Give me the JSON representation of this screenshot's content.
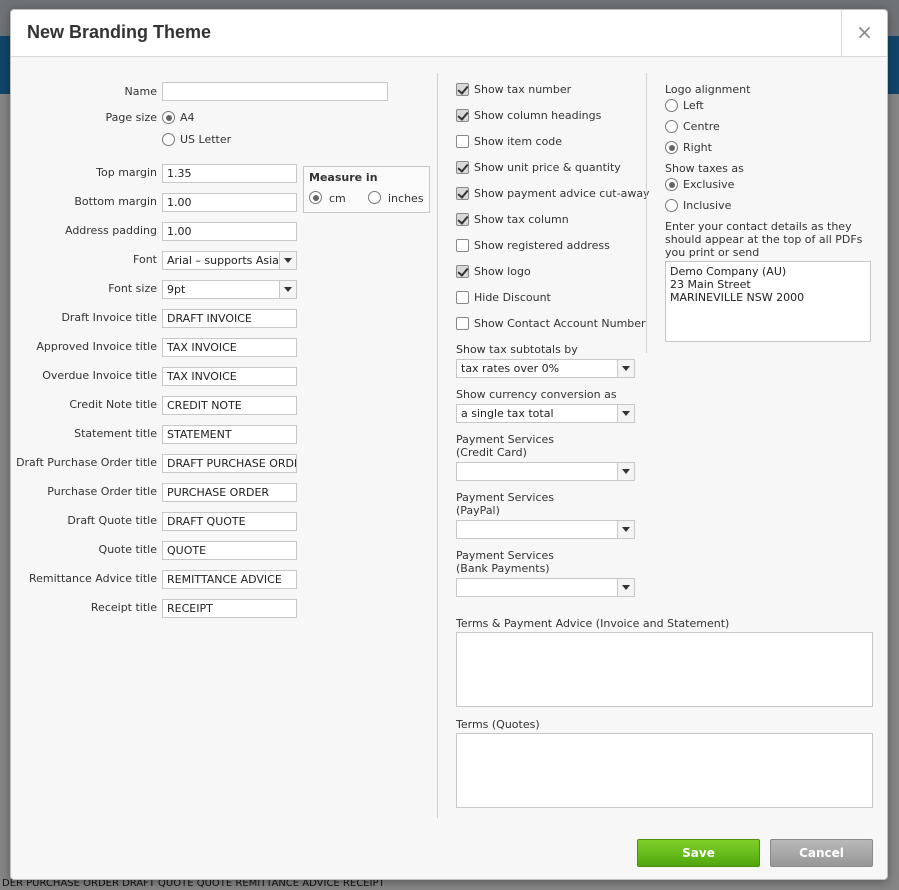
{
  "dialog": {
    "title": "New Branding Theme",
    "close_label": "×"
  },
  "background": {
    "bottom_text": "DER  PURCHASE ORDER  DRAFT QUOTE  QUOTE  REMITTANCE ADVICE  RECEIPT"
  },
  "left": {
    "name": {
      "label": "Name",
      "value": ""
    },
    "page_size": {
      "label": "Page size",
      "options": [
        "A4",
        "US Letter"
      ],
      "selected": "A4"
    },
    "top_margin": {
      "label": "Top margin",
      "value": "1.35"
    },
    "bottom_margin": {
      "label": "Bottom margin",
      "value": "1.00"
    },
    "address_padding": {
      "label": "Address padding",
      "value": "1.00"
    },
    "measure": {
      "label": "Measure in",
      "options": [
        "cm",
        "inches"
      ],
      "selected": "cm"
    },
    "font": {
      "label": "Font",
      "value": "Arial – supports Asian l"
    },
    "font_size": {
      "label": "Font size",
      "value": "9pt"
    },
    "titles": [
      {
        "label": "Draft Invoice title",
        "value": "DRAFT INVOICE"
      },
      {
        "label": "Approved Invoice title",
        "value": "TAX INVOICE"
      },
      {
        "label": "Overdue Invoice title",
        "value": "TAX INVOICE"
      },
      {
        "label": "Credit Note title",
        "value": "CREDIT NOTE"
      },
      {
        "label": "Statement title",
        "value": "STATEMENT"
      },
      {
        "label": "Draft Purchase Order title",
        "value": "DRAFT PURCHASE ORDER"
      },
      {
        "label": "Purchase Order title",
        "value": "PURCHASE ORDER"
      },
      {
        "label": "Draft Quote title",
        "value": "DRAFT QUOTE"
      },
      {
        "label": "Quote title",
        "value": "QUOTE"
      },
      {
        "label": "Remittance Advice title",
        "value": "REMITTANCE ADVICE"
      },
      {
        "label": "Receipt title",
        "value": "RECEIPT"
      }
    ]
  },
  "middle": {
    "checkboxes": [
      {
        "label": "Show tax number",
        "checked": true
      },
      {
        "label": "Show column headings",
        "checked": true
      },
      {
        "label": "Show item code",
        "checked": false
      },
      {
        "label": "Show unit price & quantity",
        "checked": true
      },
      {
        "label": "Show payment advice cut-away",
        "checked": true
      },
      {
        "label": "Show tax column",
        "checked": true
      },
      {
        "label": "Show registered address",
        "checked": false
      },
      {
        "label": "Show logo",
        "checked": true
      },
      {
        "label": "Hide Discount",
        "checked": false
      },
      {
        "label": "Show Contact Account Number",
        "checked": false
      }
    ],
    "tax_subtotals": {
      "label": "Show tax subtotals by",
      "value": "tax rates over 0%"
    },
    "currency_conversion": {
      "label": "Show currency conversion as",
      "value": "a single tax total"
    },
    "payment_credit": {
      "label_line1": "Payment Services",
      "label_line2": "(Credit Card)",
      "value": ""
    },
    "payment_paypal": {
      "label_line1": "Payment Services",
      "label_line2": "(PayPal)",
      "value": ""
    },
    "payment_bank": {
      "label_line1": "Payment Services",
      "label_line2": "(Bank Payments)",
      "value": ""
    },
    "terms_payment": {
      "label": "Terms & Payment Advice (Invoice and Statement)",
      "value": ""
    },
    "terms_quotes": {
      "label": "Terms (Quotes)",
      "value": ""
    }
  },
  "right": {
    "logo_alignment": {
      "label": "Logo alignment",
      "options": [
        "Left",
        "Centre",
        "Right"
      ],
      "selected": "Right"
    },
    "show_taxes": {
      "label": "Show taxes as",
      "options": [
        "Exclusive",
        "Inclusive"
      ],
      "selected": "Exclusive"
    },
    "contact_help": "Enter your contact details as they should appear at the top of all PDFs you print or send",
    "contact_value": "Demo Company (AU)\n23 Main Street\nMARINEVILLE NSW 2000"
  },
  "buttons": {
    "save": "Save",
    "cancel": "Cancel"
  },
  "colors": {
    "save_green": "#5cb314",
    "cancel_gray": "#a6a6a6",
    "header_blue": "#1f7fc2"
  }
}
